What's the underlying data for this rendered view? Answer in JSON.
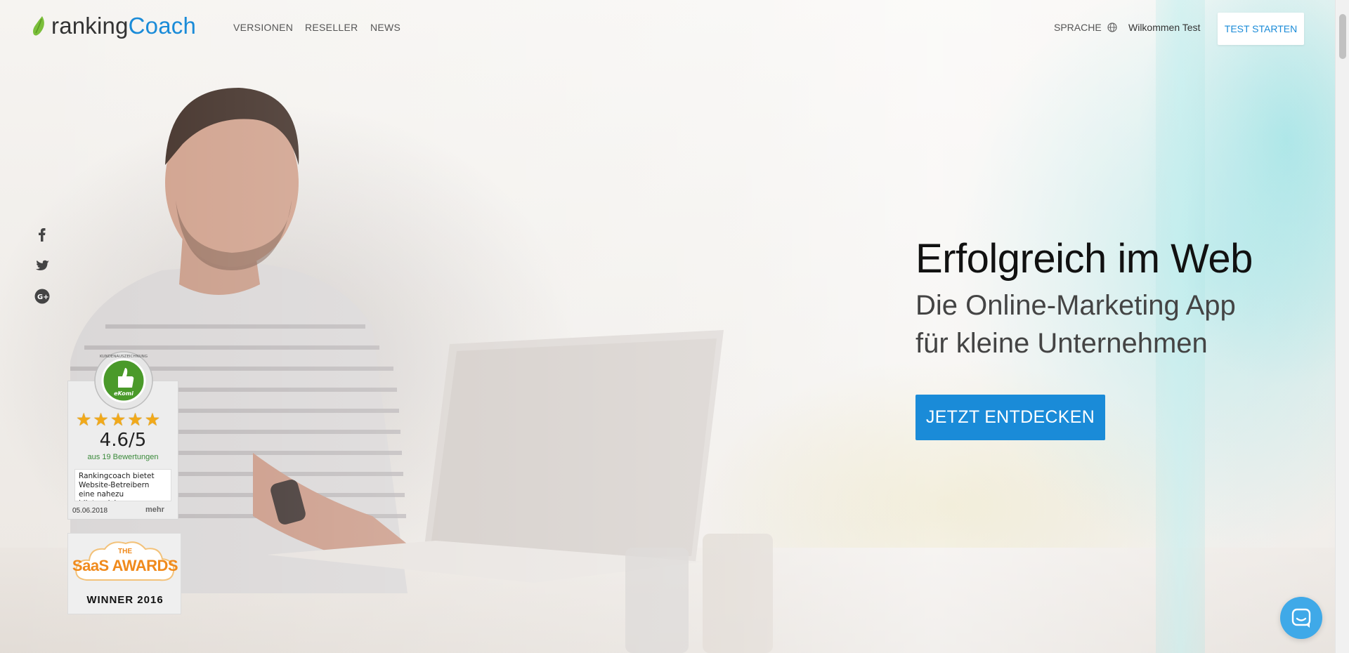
{
  "brand": {
    "name_part1": "ranking",
    "name_part2": "Coach",
    "color": "#1a8bd8"
  },
  "nav": {
    "links": [
      "VERSIONEN",
      "RESELLER",
      "NEWS"
    ],
    "language_label": "SPRACHE",
    "welcome": "Wilkommen Test",
    "cta": "TEST STARTEN"
  },
  "social": {
    "icons": [
      "facebook-icon",
      "twitter-icon",
      "google-plus-icon"
    ]
  },
  "ekomi": {
    "seal_text": "KUNDENAUSZEICHNUNG",
    "seal_brand": "eKomi",
    "score": "4.6/5",
    "count": "aus 19 Bewertungen",
    "review": "Rankingcoach bietet Website-Betreibern eine nahezu idiotensichere",
    "date": "05.06.2018",
    "more": "mehr"
  },
  "award": {
    "the": "THE",
    "name": "SaaS AWARDS",
    "winner": "WINNER 2016"
  },
  "hero": {
    "headline": "Erfolgreich im Web",
    "subline_1": "Die Online-Marketing App",
    "subline_2": "für kleine Unternehmen",
    "cta": "JETZT ENTDECKEN"
  },
  "colors": {
    "accent": "#1a8bd8",
    "chat": "#3fa9e8",
    "award_orange": "#f08a1c",
    "star": "#f1a91a"
  }
}
